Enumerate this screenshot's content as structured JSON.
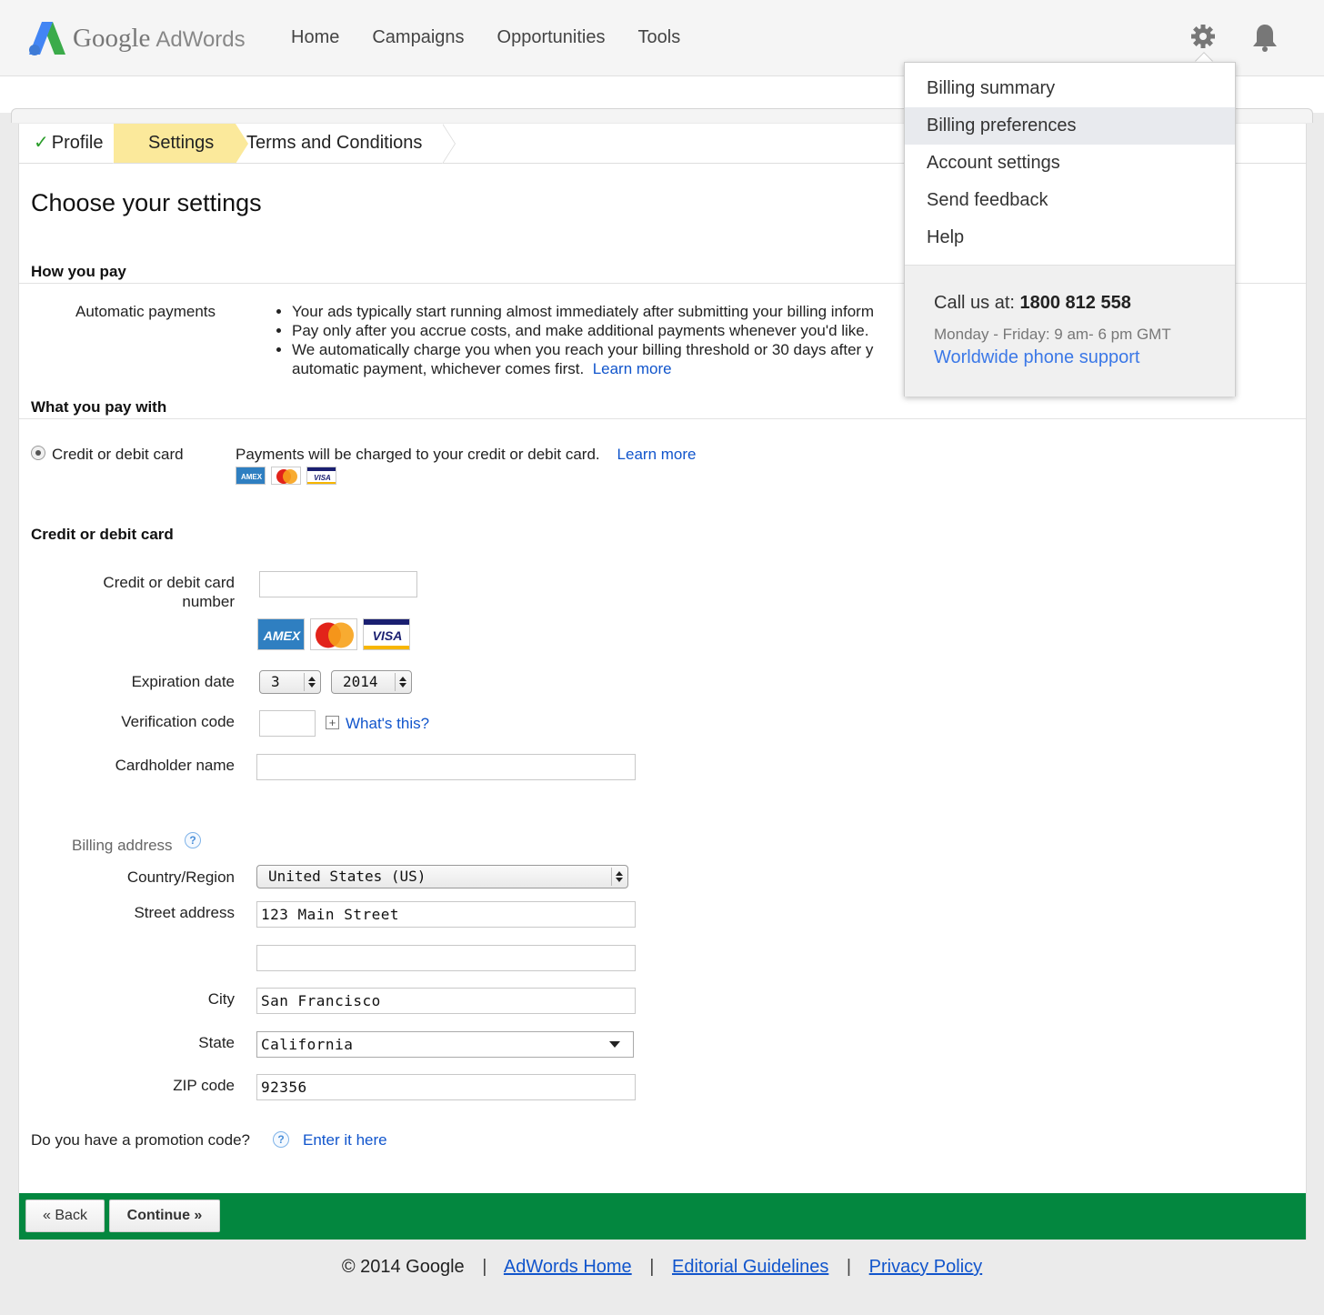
{
  "app": {
    "logo_google": "Google",
    "logo_product": "AdWords",
    "nav": [
      "Home",
      "Campaigns",
      "Opportunities",
      "Tools"
    ]
  },
  "steps": [
    {
      "label": "Profile",
      "state": "done"
    },
    {
      "label": "Settings",
      "state": "current"
    },
    {
      "label": "Terms and Conditions",
      "state": "pending"
    }
  ],
  "page_title": "Choose your settings",
  "how_you_pay": {
    "title": "How you pay",
    "label": "Automatic payments",
    "bullet_1": "Your ads typically start running almost immediately after submitting your billing inform",
    "bullet_2": "Pay only after you accrue costs, and make additional payments whenever you'd like.",
    "bullet_3a": "We automatically charge you when you reach your billing threshold or 30 days after y",
    "bullet_3b": "automatic payment, whichever comes first.",
    "learn_more": "Learn more"
  },
  "pay_with": {
    "title": "What you pay with",
    "option": "Credit or debit card",
    "desc": "Payments will be charged to your credit or debit card.",
    "learn_more": "Learn more"
  },
  "card_form": {
    "title": "Credit or debit card",
    "number_label_1": "Credit or debit card",
    "number_label_2": "number",
    "number_value": "",
    "card_brands": [
      "AMEX",
      "MasterCard",
      "VISA"
    ],
    "expiration_label": "Expiration date",
    "exp_month": "3",
    "exp_year": "2014",
    "verification_label": "Verification code",
    "verification_value": "",
    "whats_this": "What's this?",
    "cardholder_label": "Cardholder name",
    "cardholder_value": ""
  },
  "billing": {
    "title": "Billing address",
    "country_label": "Country/Region",
    "country_value": "United States (US)",
    "street_label": "Street address",
    "street_value": "123 Main Street",
    "street2_value": "",
    "city_label": "City",
    "city_value": "San Francisco",
    "state_label": "State",
    "state_value": "California",
    "zip_label": "ZIP code",
    "zip_value": "92356"
  },
  "promo": {
    "question": "Do you have a promotion code?",
    "link": "Enter it here"
  },
  "buttons": {
    "back": "« Back",
    "continue": "Continue »"
  },
  "footer": {
    "copyright": "© 2014 Google",
    "links": [
      "AdWords Home",
      "Editorial Guidelines",
      "Privacy Policy"
    ]
  },
  "menu": {
    "items": [
      "Billing summary",
      "Billing preferences",
      "Account settings",
      "Send feedback",
      "Help"
    ],
    "active_index": 1,
    "call_label": "Call us at:",
    "phone": "1800 812 558",
    "hours": "Monday - Friday: 9 am- 6 pm GMT",
    "worldwide": "Worldwide phone support"
  },
  "colors": {
    "accent_link": "#1155cc",
    "step_current": "#fbe99b",
    "footer_green": "#03873f"
  }
}
